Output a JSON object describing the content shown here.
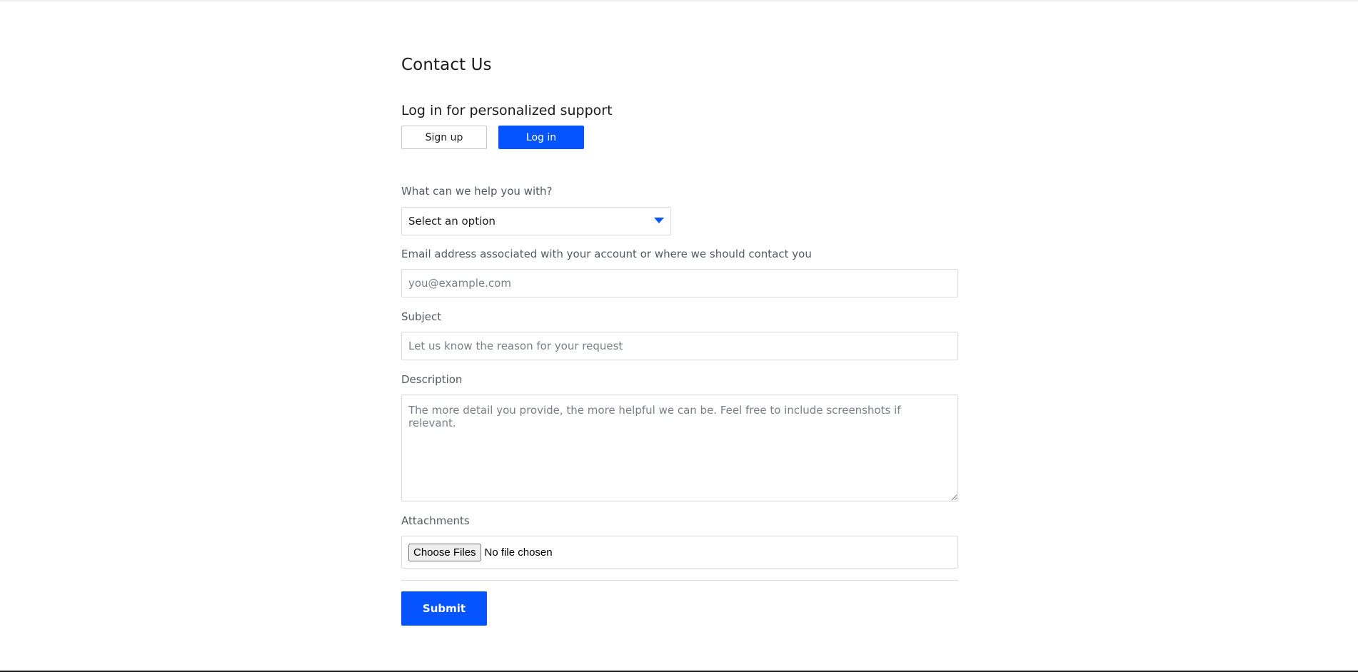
{
  "page": {
    "title": "Contact Us",
    "login_heading": "Log in for personalized support"
  },
  "auth": {
    "signup_label": "Sign up",
    "login_label": "Log in"
  },
  "form": {
    "topic_label": "What can we help you with?",
    "topic_selected": "Select an option",
    "email_label": "Email address associated with your account or where we should contact you",
    "email_placeholder": "you@example.com",
    "subject_label": "Subject",
    "subject_placeholder": "Let us know the reason for your request",
    "description_label": "Description",
    "description_placeholder": "The more detail you provide, the more helpful we can be. Feel free to include screenshots if relevant.",
    "attachments_label": "Attachments",
    "choose_files_label": "Choose Files",
    "file_status": "No file chosen",
    "submit_label": "Submit"
  },
  "colors": {
    "accent": "#0654ff",
    "border": "#dcdcdc",
    "label": "#555a60"
  }
}
